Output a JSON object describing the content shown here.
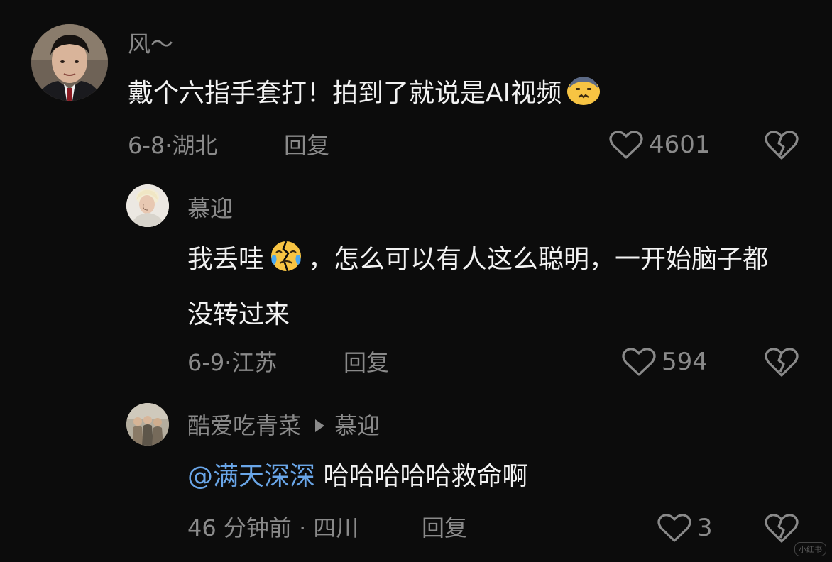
{
  "comments": [
    {
      "username": "风～",
      "text": "戴个六指手套打！拍到了就说是AI视频",
      "date": "6-8",
      "location": "湖北",
      "reply_label": "回复",
      "likes": "4601",
      "avatar_icon": "user-avatar-man-in-suit",
      "emoji_icon": "fearful-face-emoji"
    },
    {
      "username": "慕迎",
      "text_before_emoji": "我丢哇",
      "text_after_emoji": "，怎么可以有人这么聪明，一开始脑子都没转过来",
      "date": "6-9",
      "location": "江苏",
      "reply_label": "回复",
      "likes": "594",
      "avatar_icon": "user-avatar-blonde-person",
      "emoji_icon": "crying-broken-face-emoji"
    },
    {
      "username": "酷爱吃青菜",
      "reply_to": "慕迎",
      "mention": "@满天深深",
      "text": " 哈哈哈哈哈救命啊",
      "date": "46 分钟前",
      "location": "四川",
      "reply_label": "回复",
      "likes": "3",
      "avatar_icon": "user-avatar-group-photo"
    }
  ],
  "icons": {
    "like": "heart-outline-icon",
    "dislike": "broken-heart-icon"
  },
  "colors": {
    "background": "#0c0c0c",
    "text_primary": "#f2f2f2",
    "text_secondary": "#8a8a8a",
    "mention": "#6aa6e8"
  },
  "watermark": "小红书"
}
